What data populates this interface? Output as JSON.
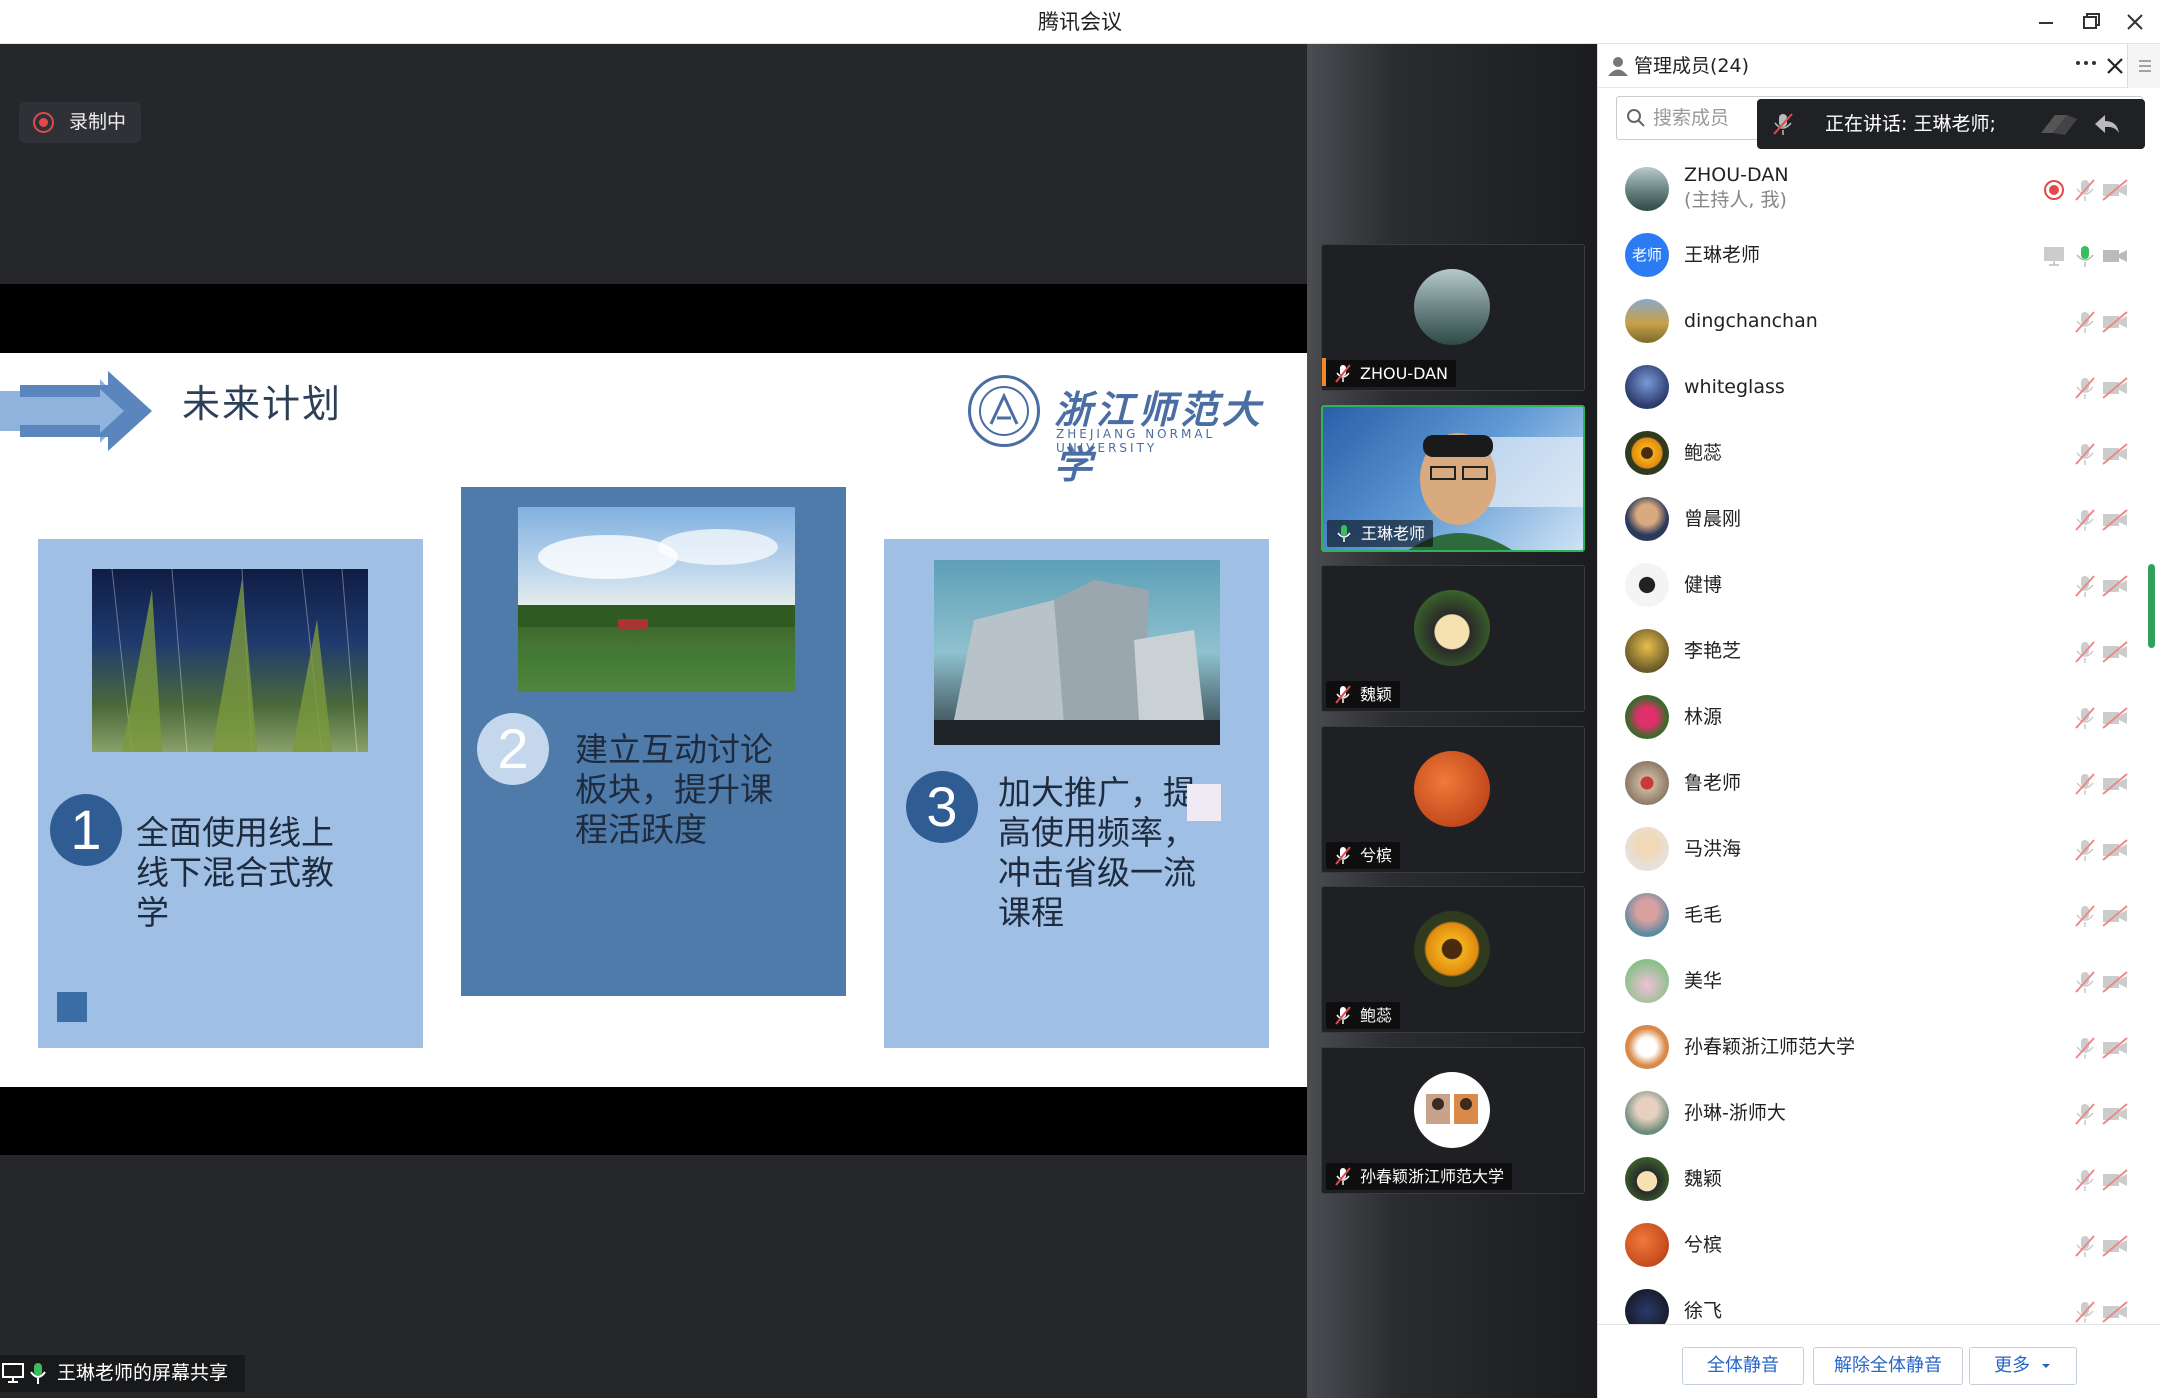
{
  "window": {
    "title": "腾讯会议"
  },
  "recording": {
    "label": "录制中"
  },
  "slide": {
    "title": "未来计划",
    "logo_cn": "浙江师范大学",
    "logo_en": "ZHEJIANG NORMAL UNIVERSITY",
    "cards": [
      {
        "num": "1",
        "text": "全面使用线上线下混合式教学"
      },
      {
        "num": "2",
        "text": "建立互动讨论板块，提升课程活跃度"
      },
      {
        "num": "3",
        "text": "加大推广，提高使用频率，冲击省级一流课程"
      }
    ]
  },
  "share_bar": {
    "label": "王琳老师的屏幕共享"
  },
  "videos": [
    {
      "name": "ZHOU-DAN"
    },
    {
      "name": "王琳老师"
    },
    {
      "name": "魏颖"
    },
    {
      "name": "兮槟"
    },
    {
      "name": "鲍蕊"
    },
    {
      "name": "孙春颖浙江师范大学"
    }
  ],
  "panel": {
    "title": "管理成员(24)",
    "search_placeholder": "搜索成员",
    "speaking": "正在讲话: 王琳老师;",
    "host_line1": "ZHOU-DAN",
    "host_line2": "(主持人, 我)",
    "teacher_avatar_text": "老师",
    "members": [
      "王琳老师",
      "dingchanchan",
      "whiteglass",
      "鲍蕊",
      "曾晨刚",
      "健博",
      "李艳芝",
      "林源",
      "鲁老师",
      "马洪海",
      "毛毛",
      "美华",
      "孙春颖浙江师范大学",
      "孙琳-浙师大",
      "魏颖",
      "兮槟",
      "徐飞"
    ],
    "buttons": {
      "mute_all": "全体静音",
      "unmute_all": "解除全体静音",
      "more": "更多"
    }
  },
  "colors": {
    "accent": "#2766c7",
    "speaking_green": "#2fb35a",
    "rec_red": "#e04a4a",
    "card_light": "#9fc0e4",
    "card_dark": "#4f7bab"
  }
}
